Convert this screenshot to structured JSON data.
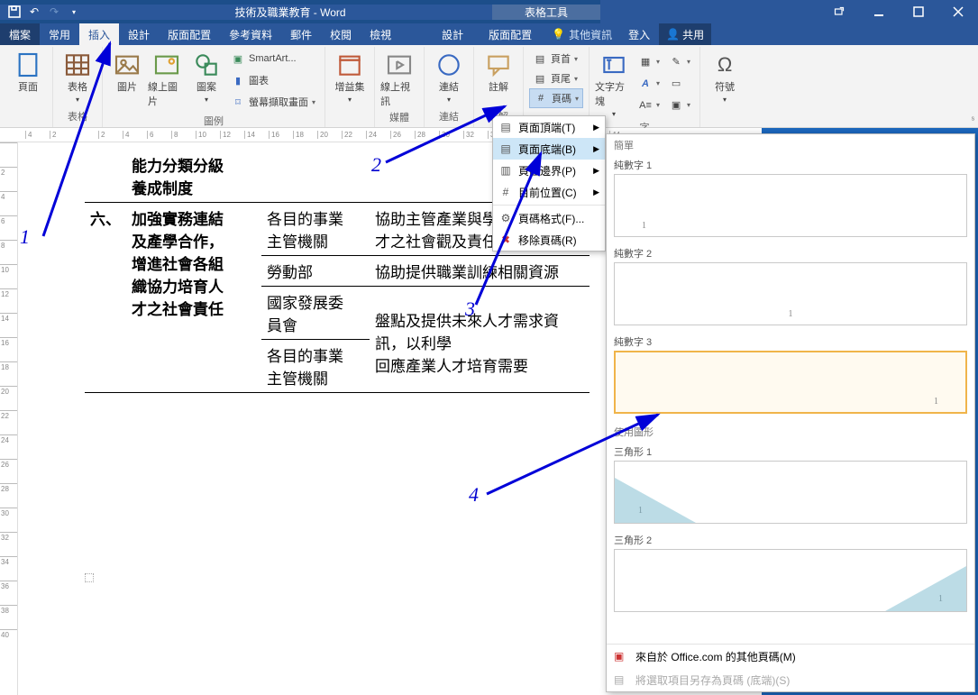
{
  "window": {
    "title": "技術及職業教育 - Word",
    "context_tab_group": "表格工具"
  },
  "tabs": {
    "file": "檔案",
    "home": "常用",
    "insert": "插入",
    "design": "設計",
    "layout": "版面配置",
    "references": "參考資料",
    "mailings": "郵件",
    "review": "校閱",
    "view": "檢視",
    "table_design": "設計",
    "table_layout": "版面配置",
    "tell_me": "其他資訊",
    "signin": "登入",
    "share": "共用"
  },
  "ribbon": {
    "pages": {
      "cover": "頁面"
    },
    "tables": {
      "label": "表格",
      "btn": "表格"
    },
    "illustrations": {
      "label": "圖例",
      "pictures": "圖片",
      "online_pictures": "線上圖片",
      "shapes": "圖案",
      "smartart": "SmartArt...",
      "chart": "圖表",
      "screenshot": "螢幕擷取畫面"
    },
    "addins": {
      "store": "增益集"
    },
    "media": {
      "label": "媒體",
      "video": "線上視訊"
    },
    "links": {
      "label": "連結",
      "btn": "連結"
    },
    "comments": {
      "label": "註解",
      "btn": "註解"
    },
    "headerfooter": {
      "header": "頁首",
      "footer": "頁尾",
      "page_number": "頁碼"
    },
    "text": {
      "textbox": "文字方塊",
      "label": "字"
    },
    "symbols": {
      "btn": "符號"
    }
  },
  "page_number_menu": {
    "top": "頁面頂端(T)",
    "bottom": "頁面底端(B)",
    "margins": "頁面邊界(P)",
    "current": "目前位置(C)",
    "format": "頁碼格式(F)...",
    "remove": "移除頁碼(R)"
  },
  "gallery": {
    "section_simple": "簡單",
    "items": {
      "plain1": "純數字 1",
      "plain2": "純數字 2",
      "plain3": "純數字 3"
    },
    "section_shapes": "使用圖形",
    "shape_items": {
      "tri1": "三角形 1",
      "tri2": "三角形 2"
    },
    "footer_office": "來自於 Office.com 的其他頁碼(M)",
    "footer_save": "將選取項目另存為頁碼 (底端)(S)"
  },
  "doc": {
    "r0a": "能力分類分級",
    "r0b": "養成制度",
    "r1_num": "六、",
    "r1_title1": "加強實務連結",
    "r1_title2": "及產學合作，",
    "r1_title3": "增進社會各組",
    "r1_title4": "織協力培育人",
    "r1_title5": "才之社會責任",
    "r1c2a": "各目的事業",
    "r1c2b": "主管機關",
    "r1c3a": "協助主管產業與學校合",
    "r1c3b": "才之社會觀及責任感",
    "r2c2": "勞動部",
    "r2c3": "協助提供職業訓練相關資源",
    "r3c2a": "國家發展委",
    "r3c2b": "員會",
    "r3c3a": "盤點及提供未來人才需求資訊，以利學",
    "r3c3b": "回應產業人才培育需要",
    "r4c2a": "各目的事業",
    "r4c2b": "主管機關"
  },
  "annotations": {
    "n1": "1",
    "n2": "2",
    "n3": "3",
    "n4": "4"
  }
}
